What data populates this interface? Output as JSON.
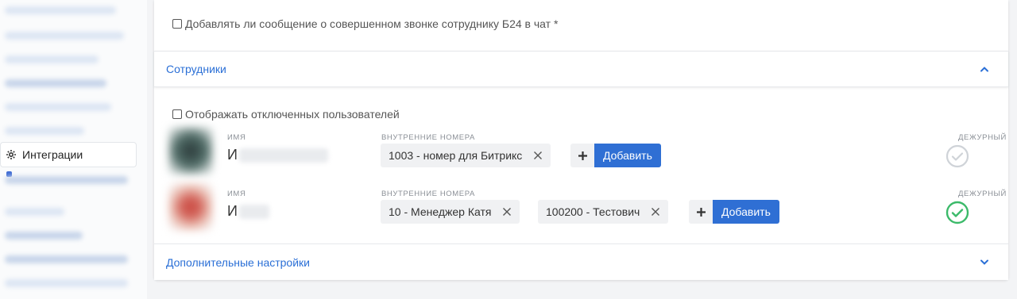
{
  "sidebar": {
    "active_item": {
      "label": "Интеграции",
      "icon": "gear-icon"
    }
  },
  "settings": {
    "chat_message_checkbox": {
      "label": "Добавлять ли сообщение о совершенном звонке сотруднику Б24 в чат *",
      "checked": false
    }
  },
  "employees_section": {
    "title": "Сотрудники",
    "expanded": true,
    "show_disabled_checkbox": {
      "label": "Отображать отключенных пользователей",
      "checked": false
    },
    "column_labels": {
      "name": "ИМЯ",
      "numbers": "ВНУТРЕННИЕ НОМЕРА",
      "duty": "ДЕЖУРНЫЙ"
    },
    "add_label": "Добавить",
    "rows": [
      {
        "name_initial": "И",
        "numbers": [
          "1003 - номер для Битрикс"
        ],
        "on_duty": false
      },
      {
        "name_initial": "И",
        "numbers": [
          "10 - Менеджер Катя",
          "100200 - Тестович"
        ],
        "on_duty": true
      }
    ]
  },
  "additional_section": {
    "title": "Дополнительные настройки",
    "expanded": false
  },
  "colors": {
    "accent": "#2f6fd4",
    "link": "#2a6fd6",
    "duty_on": "#3cba6a",
    "duty_off": "#cfd3d8"
  }
}
